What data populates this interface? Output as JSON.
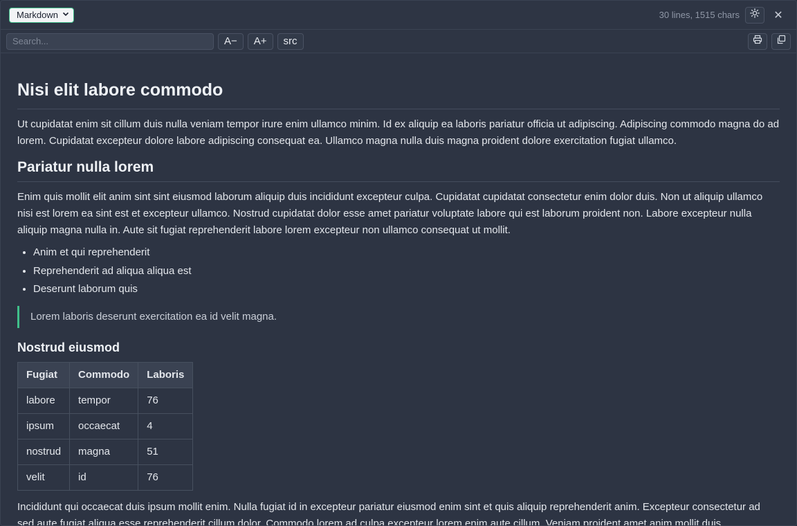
{
  "topbar": {
    "mode": "Markdown",
    "stats": "30 lines, 1515 chars",
    "theme_icon": "sun-icon",
    "close_label": "✕"
  },
  "toolbar": {
    "search_placeholder": "Search...",
    "font_smaller": "A−",
    "font_larger": "A+",
    "src_label": "src",
    "print_icon": "printer-icon",
    "copy_icon": "copy-icon"
  },
  "doc": {
    "h1": "Nisi elit labore commodo",
    "p1": "Ut cupidatat enim sit cillum duis nulla veniam tempor irure enim ullamco minim. Id ex aliquip ea laboris pariatur officia ut adipiscing. Adipiscing commodo magna do ad lorem. Cupidatat excepteur dolore labore adipiscing consequat ea. Ullamco magna nulla duis magna proident dolore exercitation fugiat ullamco.",
    "h2": "Pariatur nulla lorem",
    "p2": "Enim quis mollit elit anim sint sint eiusmod laborum aliquip duis incididunt excepteur culpa. Cupidatat cupidatat consectetur enim dolor duis. Non ut aliquip ullamco nisi est lorem ea sint est et excepteur ullamco. Nostrud cupidatat dolor esse amet pariatur voluptate labore qui est laborum proident non. Labore excepteur nulla aliquip magna nulla in. Aute sit fugiat reprehenderit labore lorem excepteur non ullamco consequat ut mollit.",
    "list": [
      "Anim et qui reprehenderit",
      "Reprehenderit ad aliqua aliqua est",
      "Deserunt laborum quis"
    ],
    "quote": "Lorem laboris deserunt exercitation ea id velit magna.",
    "h3": "Nostrud eiusmod",
    "table": {
      "headers": [
        "Fugiat",
        "Commodo",
        "Laboris"
      ],
      "rows": [
        [
          "labore",
          "tempor",
          "76"
        ],
        [
          "ipsum",
          "occaecat",
          "4"
        ],
        [
          "nostrud",
          "magna",
          "51"
        ],
        [
          "velit",
          "id",
          "76"
        ]
      ]
    },
    "p3": "Incididunt qui occaecat duis ipsum mollit enim. Nulla fugiat id in excepteur pariatur eiusmod enim sint et quis aliquip reprehenderit anim. Excepteur consectetur ad sed aute fugiat aliqua esse reprehenderit cillum dolor. Commodo lorem ad culpa excepteur lorem enim aute cillum. Veniam proident amet anim mollit duis"
  }
}
